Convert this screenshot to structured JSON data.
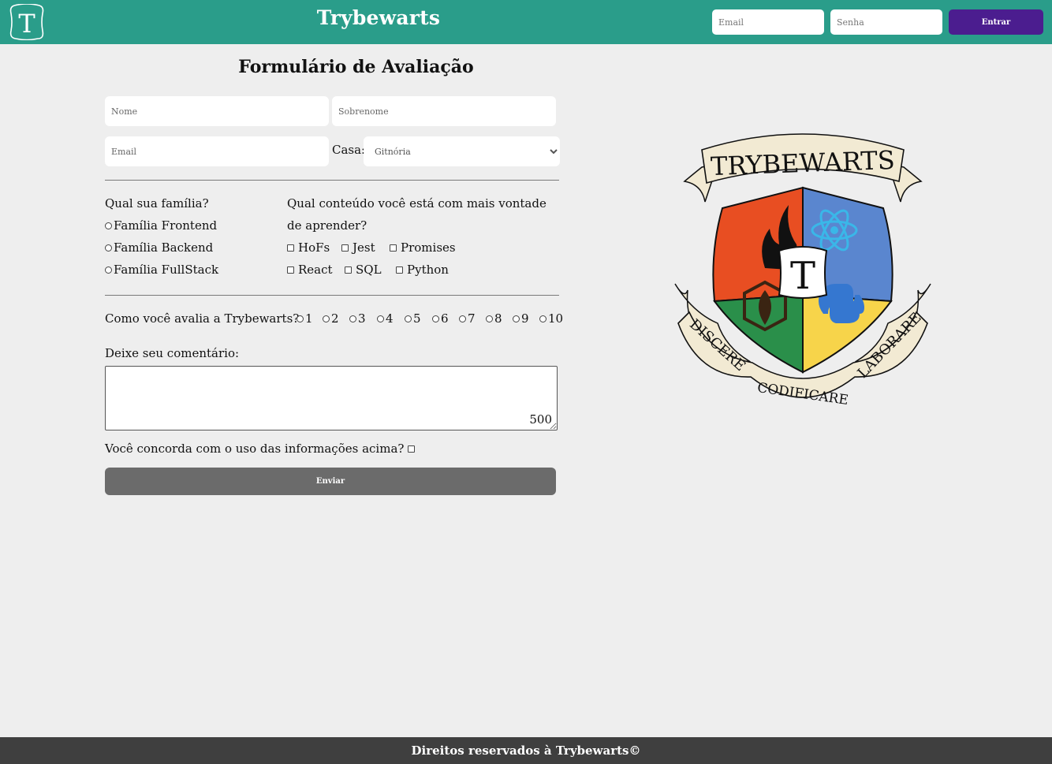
{
  "header": {
    "logo_letter": "T",
    "title": "Trybewarts",
    "email_placeholder": "Email",
    "password_placeholder": "Senha",
    "login_label": "Entrar",
    "bg_color": "#2a9d8a",
    "button_color": "#4b1d8f"
  },
  "form": {
    "title": "Formulário de Avaliação",
    "name_placeholder": "Nome",
    "lastname_placeholder": "Sobrenome",
    "email_placeholder": "Email",
    "house_label": "Casa:",
    "house_selected": "Gitnória",
    "family": {
      "question": "Qual sua família?",
      "options": [
        "Família Frontend",
        "Família Backend",
        "Família FullStack"
      ]
    },
    "content": {
      "question_line1": "Qual conteúdo você está com mais vontade",
      "question_line2": "de aprender?",
      "options": [
        "HoFs",
        "Jest",
        "Promises",
        "React",
        "SQL",
        "Python"
      ]
    },
    "rating": {
      "question": "Como você avalia a Trybewarts?",
      "options": [
        "1",
        "2",
        "3",
        "4",
        "5",
        "6",
        "7",
        "8",
        "9",
        "10"
      ]
    },
    "comment_label": "Deixe seu comentário:",
    "counter": "500",
    "agree_label": "Você concorda com o uso das informações acima?",
    "submit_label": "Enviar"
  },
  "crest": {
    "banner_top": "TRYBEWARTS",
    "center_letter": "T",
    "banner_left": "DISCERE",
    "banner_bottom": "CODIFICARE",
    "banner_right": "LABORARE"
  },
  "footer": {
    "text": "Direitos reservados à Trybewarts©"
  }
}
